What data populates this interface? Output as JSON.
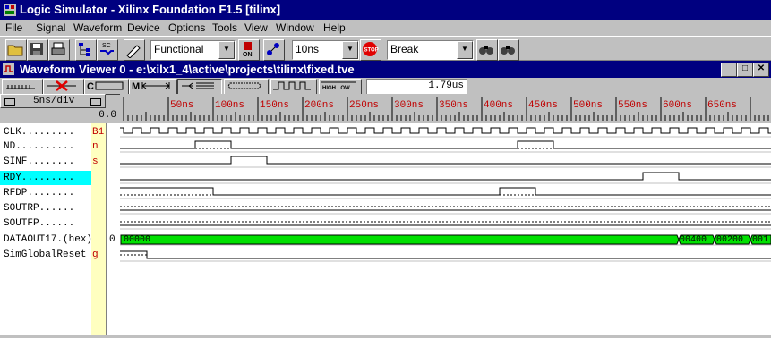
{
  "window": {
    "title": "Logic Simulator - Xilinx Foundation F1.5 [tilinx]"
  },
  "menu": [
    "File",
    "Signal",
    "Waveform",
    "Device",
    "Options",
    "Tools",
    "View",
    "Window",
    "Help"
  ],
  "toolbar": {
    "mode": "Functional",
    "step": "10ns",
    "break": "Break",
    "on_label": "ON",
    "stop_label": "STOP",
    "sc_label": "SC"
  },
  "waveform_window": {
    "title": "Waveform Viewer 0 - e:\\xilx1_4\\active\\projects\\tilinx\\fixed.tve",
    "time_display": "1.79us",
    "scale": "5ns/div",
    "origin": "0.0",
    "hl_label": "HIGH LOW"
  },
  "ruler": [
    "50ns",
    "100ns",
    "150ns",
    "200ns",
    "250ns",
    "300ns",
    "350ns",
    "400ns",
    "450ns",
    "500ns",
    "550ns",
    "600ns",
    "650ns"
  ],
  "signals": [
    {
      "name": "CLK.........",
      "val": "B1"
    },
    {
      "name": "ND..........",
      "val": "n"
    },
    {
      "name": "SINF........",
      "val": "s"
    },
    {
      "name": "RDY.........",
      "val": ""
    },
    {
      "name": "RFDP........",
      "val": ""
    },
    {
      "name": "SOUTRP......",
      "val": ""
    },
    {
      "name": "SOUTFP......",
      "val": ""
    },
    {
      "name": "DATAOUT17.(hex)",
      "val": "0"
    },
    {
      "name": "SimGlobalReset",
      "val": "g"
    }
  ],
  "bus_values": [
    "00000",
    "00400",
    "00200",
    "001"
  ],
  "colors": {
    "bus_fill": "#00e000",
    "selected_row": "#00ffff",
    "title": "#000080",
    "value_col": "#ffffc0"
  }
}
